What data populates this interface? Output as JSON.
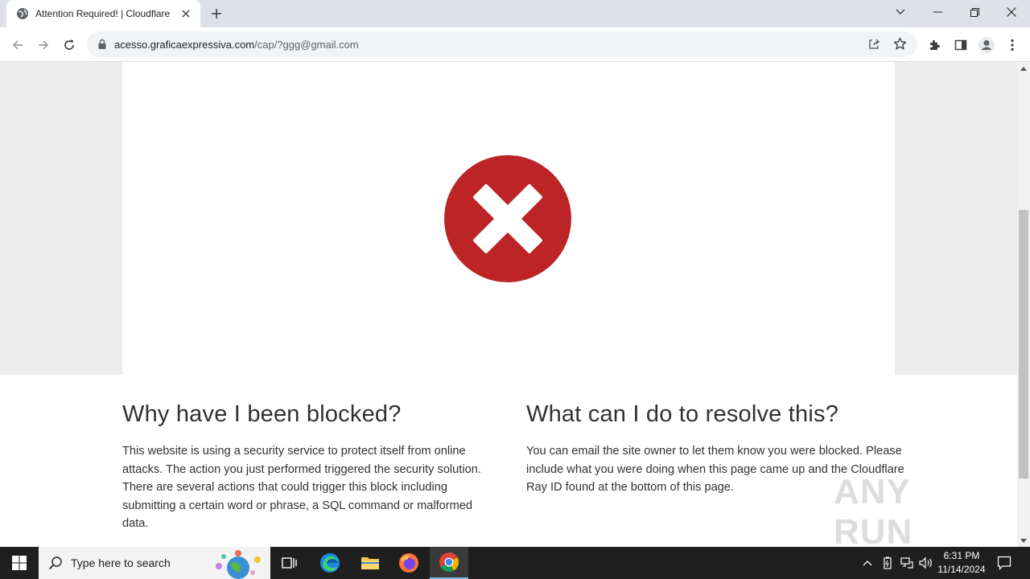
{
  "browser": {
    "tab_title": "Attention Required! | Cloudflare",
    "url_host": "acesso.graficaexpressiva.com",
    "url_path": "/cap/?ggg@gmail.com"
  },
  "page": {
    "blocked_heading": "Why have I been blocked?",
    "blocked_text": "This website is using a security service to protect itself from online attacks. The action you just performed triggered the security solution. There are several actions that could trigger this block including submitting a certain word or phrase, a SQL command or malformed data.",
    "resolve_heading": "What can I do to resolve this?",
    "resolve_text": "You can email the site owner to let them know you were blocked. Please include what you were doing when this page came up and the Cloudflare Ray ID found at the bottom of this page.",
    "error_color": "#bd2426"
  },
  "watermark": {
    "text": "ANY RUN"
  },
  "taskbar": {
    "search_placeholder": "Type here to search",
    "time": "6:31 PM",
    "date": "11/14/2024"
  }
}
